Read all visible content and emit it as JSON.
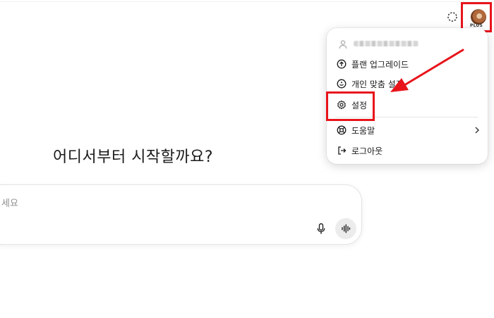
{
  "header": {
    "temporary_chat_icon": "dashed-circle-icon",
    "account_badge": "PLUS"
  },
  "menu": {
    "email_masked": "",
    "items": [
      {
        "label": "플랜 업그레이드",
        "icon": "upgrade-icon"
      },
      {
        "label": "개인 맞춤 설정",
        "icon": "personalize-icon"
      },
      {
        "label": "설정",
        "icon": "gear-icon"
      },
      {
        "label": "도움말",
        "icon": "lifebuoy-icon"
      },
      {
        "label": "로그아웃",
        "icon": "logout-icon"
      }
    ]
  },
  "main": {
    "headline": "어디서부터 시작할까요?",
    "composer_placeholder": "세요"
  },
  "annotation": {
    "highlight_color": "#e8141b"
  }
}
